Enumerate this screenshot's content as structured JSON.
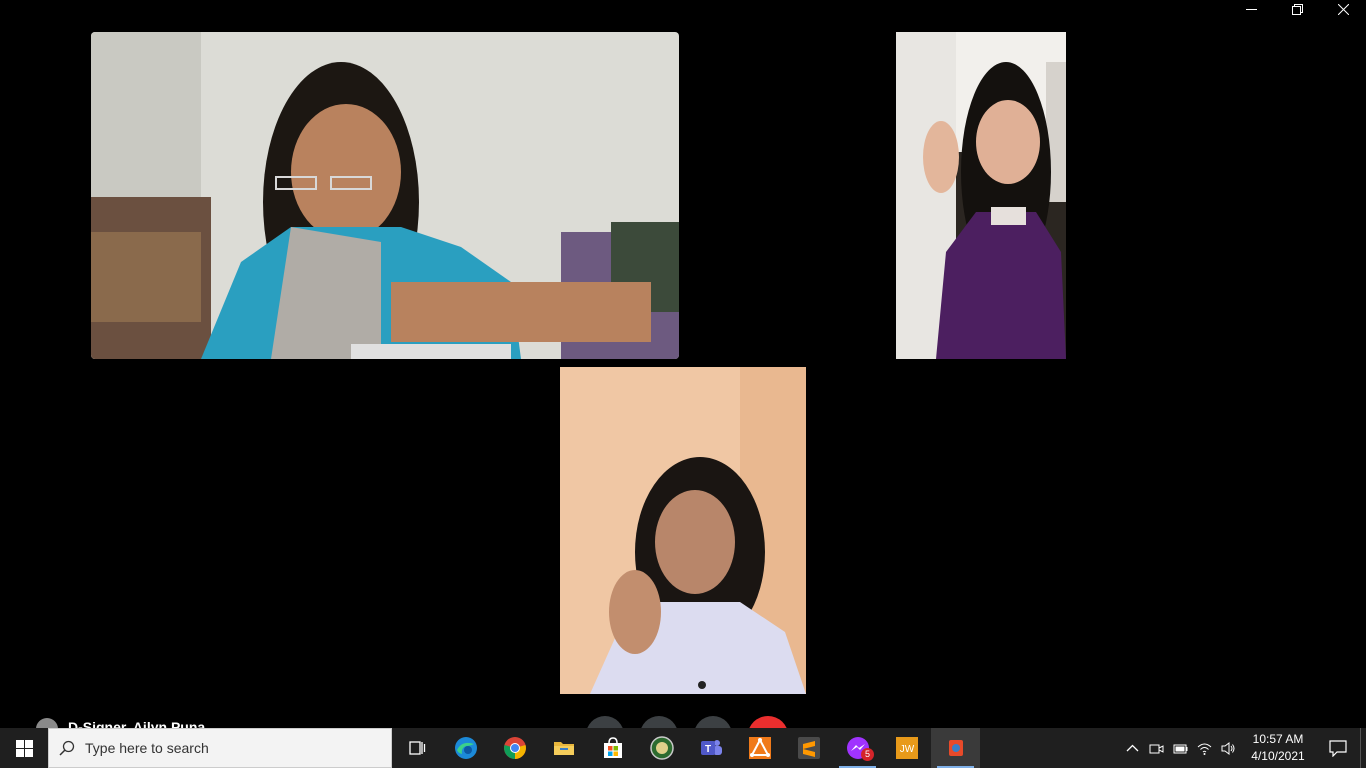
{
  "window": {
    "minimize_icon": "minimize-icon",
    "restore_icon": "restore-icon",
    "close_icon": "close-icon"
  },
  "meeting": {
    "participant_name": "D-Signer, Ailyn Puna",
    "reaction_icon": "emoji-reaction-icon",
    "end_call_color": "#ea2e2e"
  },
  "taskbar": {
    "search_placeholder": "Type here to search",
    "apps": [
      "task-view",
      "edge",
      "chrome",
      "file-explorer",
      "microsoft-store",
      "seal-app",
      "teams",
      "office-app",
      "sublime-text",
      "messenger",
      "jw-library",
      "active-app"
    ],
    "messenger_badge": "5",
    "clock_time": "10:57 AM",
    "clock_date": "4/10/2021"
  }
}
